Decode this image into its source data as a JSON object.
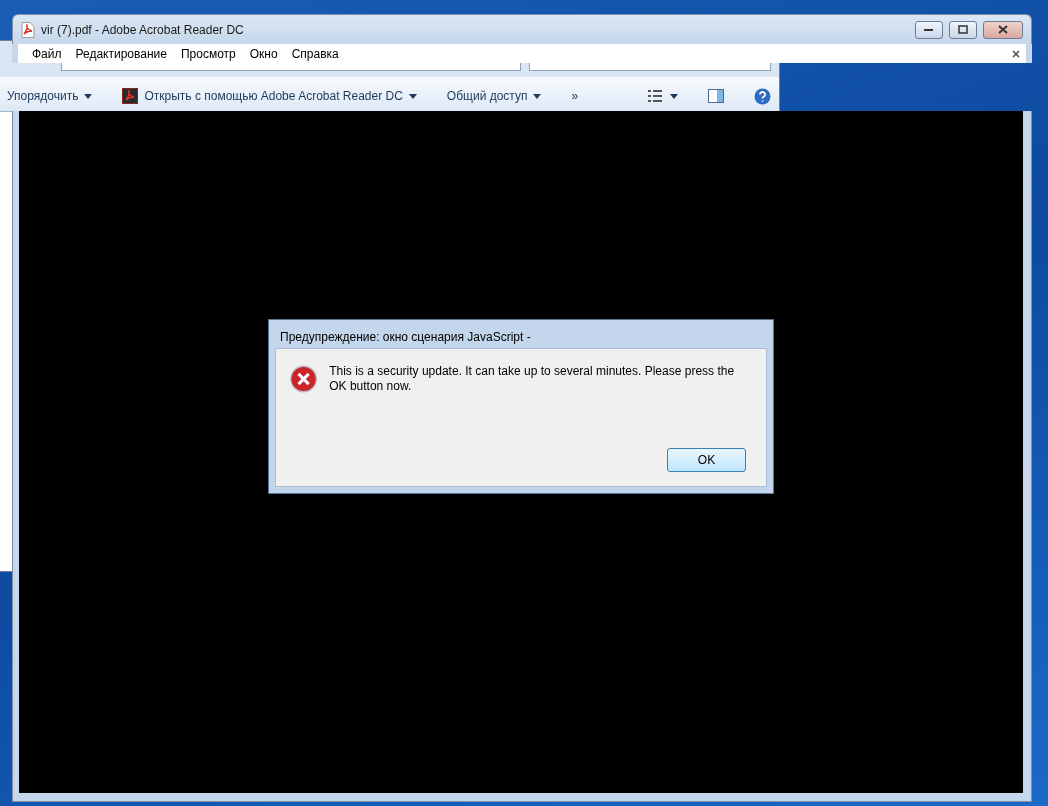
{
  "explorer_toolbar": {
    "items": [
      {
        "kind": "menu",
        "label": "Упорядочить"
      },
      {
        "kind": "app",
        "label": "Открыть с помощью Adobe Acrobat Reader DC"
      },
      {
        "kind": "menu",
        "label": "Общий доступ"
      },
      {
        "kind": "more",
        "label": "»"
      }
    ]
  },
  "acrobat_window": {
    "title": "vir  (7).pdf - Adobe Acrobat Reader DC",
    "menu": [
      "Файл",
      "Редактирование",
      "Просмотр",
      "Окно",
      "Справка"
    ]
  },
  "dialog": {
    "title": "Предупреждение: окно сценария JavaScript -",
    "message": "This is a security update. It can take up to several minutes. Please press the OK button now.",
    "buttons": [
      "OK"
    ]
  }
}
